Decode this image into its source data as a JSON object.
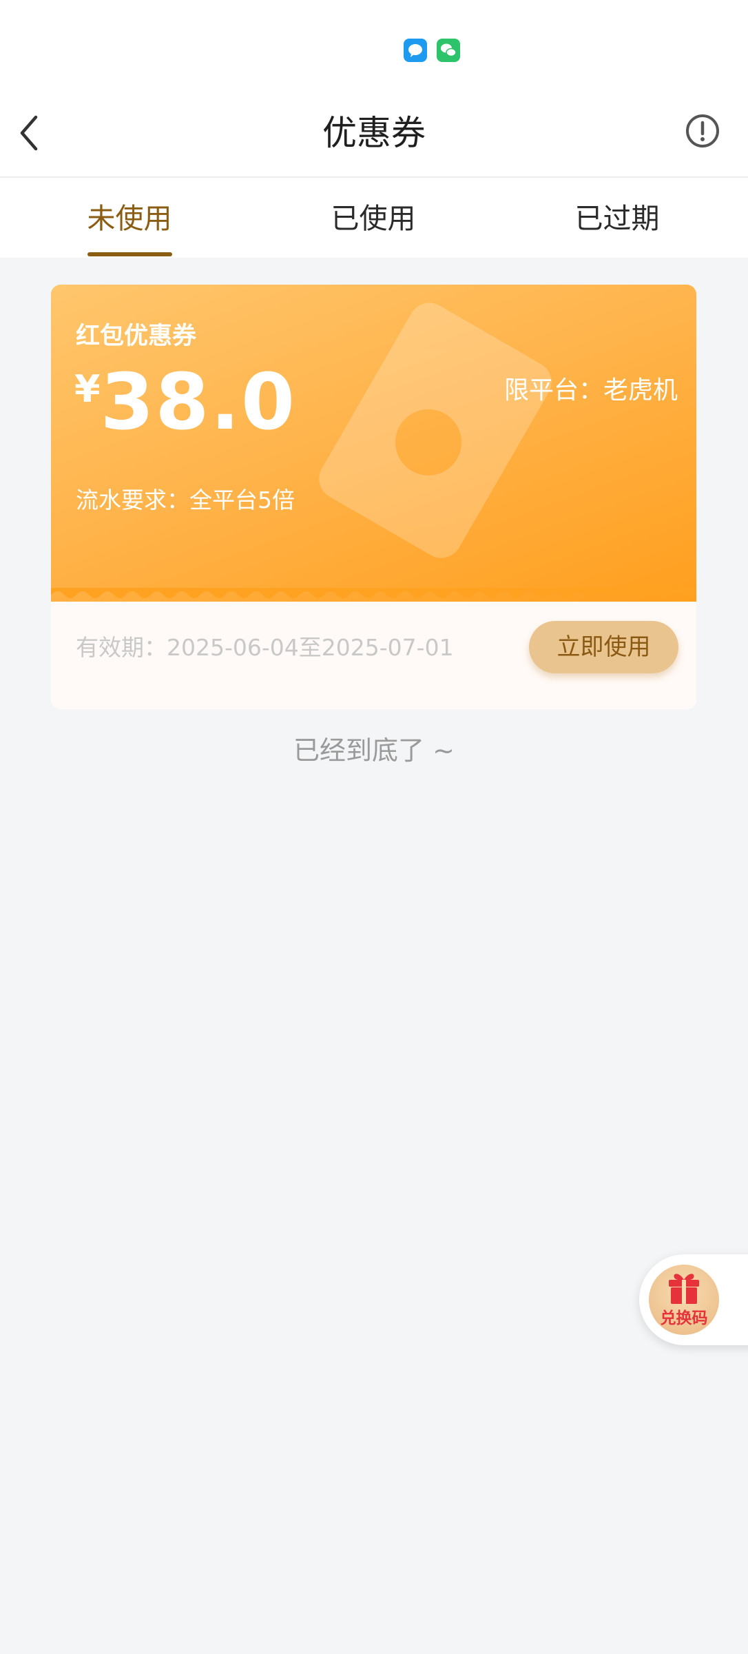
{
  "header": {
    "title": "优惠券"
  },
  "tabs": [
    {
      "label": "未使用",
      "active": true
    },
    {
      "label": "已使用",
      "active": false
    },
    {
      "label": "已过期",
      "active": false
    }
  ],
  "coupon": {
    "name": "红包优惠券",
    "currency": "¥",
    "amount": "38.0",
    "platform": "限平台：老虎机",
    "wager": "流水要求：全平台5倍",
    "validity": "有效期：2025-06-04至2025-07-01",
    "use_button": "立即使用"
  },
  "end_text": "已经到底了 ~",
  "redeem": {
    "label": "兑换码"
  },
  "colors": {
    "accent": "#8a5d12",
    "coupon_orange": "#ffa726",
    "button_bg": "#e9c48e",
    "redeem_red": "#e6323a"
  }
}
